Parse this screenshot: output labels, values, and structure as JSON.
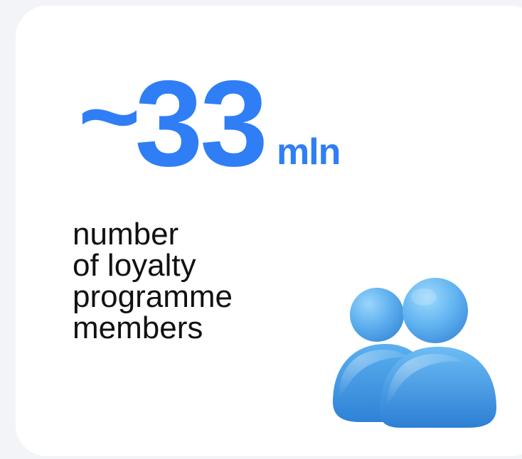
{
  "stat": {
    "prefix": "~",
    "value": "33",
    "unit": "mln"
  },
  "description": {
    "lines": [
      "number",
      "of loyalty",
      "programme",
      "members"
    ]
  },
  "icon": {
    "name": "users-icon"
  },
  "colors": {
    "accent": "#2f7ef5",
    "text": "#111111",
    "card": "#ffffff",
    "background": "#f3f4f8",
    "icon_light": "#6fbcf5",
    "icon_dark": "#2c86de"
  }
}
